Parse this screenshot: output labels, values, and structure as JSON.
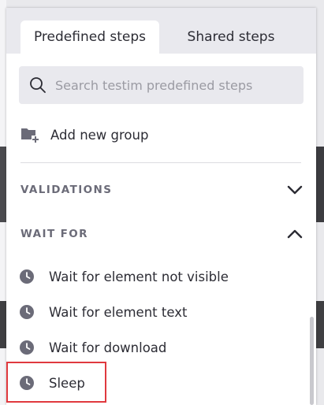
{
  "tabs": [
    {
      "label": "Predefined steps",
      "active": true
    },
    {
      "label": "Shared steps",
      "active": false
    }
  ],
  "search": {
    "placeholder": "Search testim predefined steps",
    "value": ""
  },
  "add_group": {
    "label": "Add new group"
  },
  "sections": [
    {
      "label": "VALIDATIONS",
      "expanded": false
    },
    {
      "label": "WAIT FOR",
      "expanded": true
    }
  ],
  "steps": [
    {
      "label": "Wait for element not visible"
    },
    {
      "label": "Wait for element text"
    },
    {
      "label": "Wait for download"
    },
    {
      "label": "Sleep",
      "highlighted": true
    }
  ],
  "colors": {
    "accent_highlight": "#e0393e",
    "text": "#2c2c34",
    "muted": "#6b6b78",
    "tab_bar": "#e9e9ee"
  },
  "icons": [
    "search-icon",
    "folder-plus-icon",
    "chevron-down-icon",
    "chevron-up-icon",
    "clock-icon"
  ]
}
